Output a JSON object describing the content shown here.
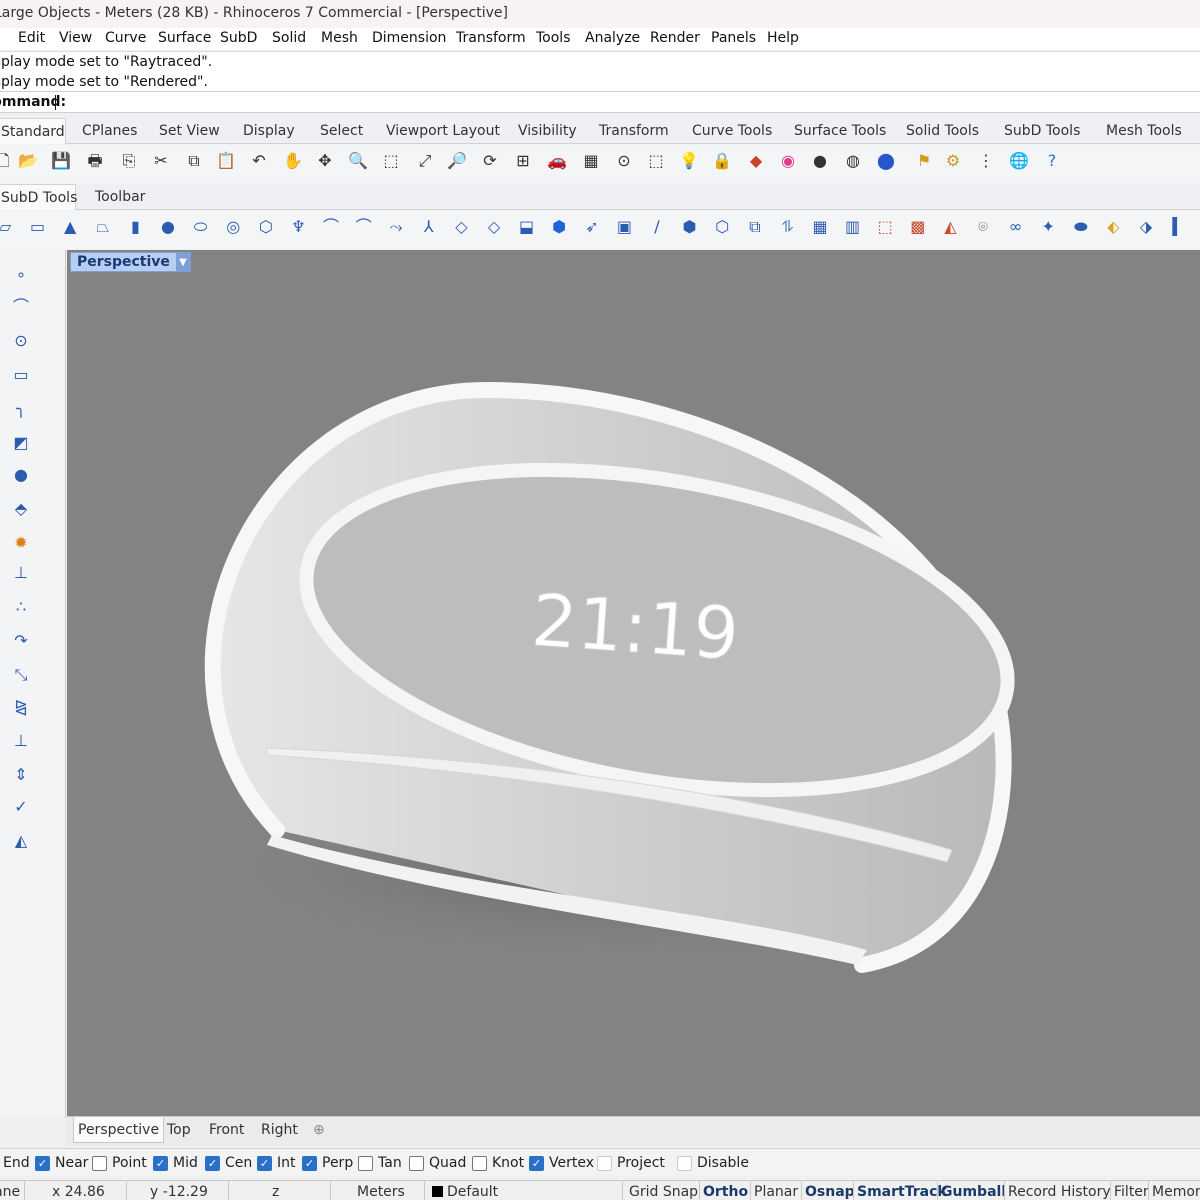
{
  "window": {
    "title": "Large Objects - Meters (28 KB) - Rhinoceros 7 Commercial - [Perspective]"
  },
  "menu": [
    "Edit",
    "View",
    "Curve",
    "Surface",
    "SubD",
    "Solid",
    "Mesh",
    "Dimension",
    "Transform",
    "Tools",
    "Analyze",
    "Render",
    "Panels",
    "Help"
  ],
  "command": {
    "history": [
      "Display mode set to \"Raytraced\".",
      "Display mode set to \"Rendered\"."
    ],
    "prompt": "Command:"
  },
  "toolbar_tabs": [
    "Standard",
    "CPlanes",
    "Set View",
    "Display",
    "Select",
    "Viewport Layout",
    "Visibility",
    "Transform",
    "Curve Tools",
    "Surface Tools",
    "Solid Tools",
    "SubD Tools",
    "Mesh Tools"
  ],
  "active_toolbar_tab": "Standard",
  "standard_icons": [
    "new-icon",
    "open-icon",
    "save-icon",
    "print-icon",
    "import-icon",
    "cut-icon",
    "copy-icon",
    "paste-icon",
    "undo-icon",
    "pan-icon",
    "move-view-icon",
    "zoom-icon",
    "zoom-window-icon",
    "zoom-extents-icon",
    "zoom-selected-icon",
    "rotate-view-icon",
    "viewport-layout-icon",
    "car-icon",
    "grid-icon",
    "point-icon",
    "layer-icon",
    "light-icon",
    "lock-icon",
    "material-icon",
    "color-wheel-icon",
    "shaded-sphere-icon",
    "render-sphere-icon",
    "blue-sphere-icon",
    "flag-icon",
    "gear-icon",
    "options-icon",
    "globe-icon",
    "help-icon"
  ],
  "sub_tabs": [
    "SubD Tools",
    "Toolbar"
  ],
  "subd_icons": [
    "subd-plane-icon",
    "subd-box-icon",
    "subd-cone-icon",
    "subd-truncated-cone-icon",
    "subd-cylinder-icon",
    "subd-sphere-icon",
    "subd-ellipsoid-icon",
    "subd-torus-icon",
    "subd-geodesic-icon",
    "subd-stretch-icon",
    "subd-loft-1-icon",
    "subd-loft-2-icon",
    "subd-sweep-icon",
    "subd-y-icon",
    "subd-bridge-icon",
    "subd-fill-icon",
    "subd-extrude-icon",
    "subd-cube-icon",
    "subd-offset-icon",
    "subd-crease-icon",
    "subd-weld-icon",
    "subd-split-icon",
    "subd-slide-icon",
    "subd-merge-icon",
    "subd-insert-edge-icon",
    "subd-mesh-icon",
    "subd-grid-icon",
    "subd-tag-icon",
    "subd-color-grid-icon",
    "subd-fold-icon",
    "subd-cup-icon",
    "subd-symmetry-icon",
    "subd-star-icon",
    "subd-pipe-icon",
    "subd-map-icon",
    "subd-convert-icon",
    "subd-panel-icon"
  ],
  "side_icons": [
    "point-icon",
    "curve-icon",
    "circle-icon",
    "rectangle-icon",
    "arc-icon",
    "surface-icon",
    "solid-icon",
    "mesh-icon",
    "explode-icon",
    "dimension-icon",
    "array-icon",
    "fillet-icon",
    "scale-icon",
    "mirror-icon",
    "project-icon",
    "align-icon",
    "check-icon",
    "analyze-icon"
  ],
  "viewport": {
    "active": "Perspective",
    "clock_text": "21:19"
  },
  "viewport_tabs": [
    "Perspective",
    "Top",
    "Front",
    "Right"
  ],
  "osnaps": [
    {
      "label": "End",
      "checked": true
    },
    {
      "label": "Near",
      "checked": true
    },
    {
      "label": "Point",
      "checked": false
    },
    {
      "label": "Mid",
      "checked": true
    },
    {
      "label": "Cen",
      "checked": true
    },
    {
      "label": "Int",
      "checked": true
    },
    {
      "label": "Perp",
      "checked": true
    },
    {
      "label": "Tan",
      "checked": false
    },
    {
      "label": "Quad",
      "checked": false
    },
    {
      "label": "Knot",
      "checked": false
    },
    {
      "label": "Vertex",
      "checked": true
    },
    {
      "label": "Project",
      "checked": false
    },
    {
      "label": "Disable",
      "checked": false
    }
  ],
  "status": {
    "cplane": "CPlane",
    "x": "x 24.86",
    "y": "y -12.29",
    "z": "z",
    "units": "Meters",
    "layer": "Default",
    "toggles": [
      "Grid Snap",
      "Ortho",
      "Planar",
      "Osnap",
      "SmartTrack",
      "Gumball",
      "Record History",
      "Filter",
      "Memory"
    ],
    "active_toggles": [
      "Ortho",
      "Osnap",
      "SmartTrack",
      "Gumball"
    ]
  },
  "colors": {
    "viewport_bg": "#838383",
    "active_label": "#b8cdf0",
    "checkbox": "#2870c8"
  }
}
